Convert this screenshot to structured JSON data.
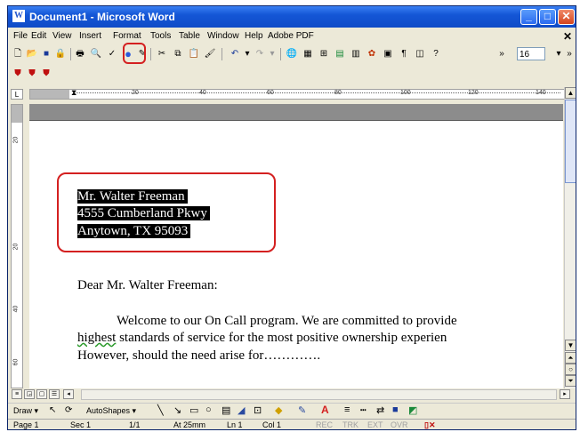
{
  "window": {
    "title": "Document1 - Microsoft Word",
    "title_buttons": [
      "_",
      "□",
      "✕"
    ]
  },
  "menubar": {
    "items": [
      "File",
      "Edit",
      "View",
      "Insert",
      "Format",
      "Tools",
      "Table",
      "Window",
      "Help",
      "Adobe PDF"
    ],
    "close_doc": "✕"
  },
  "toolbar": {
    "font_size": "16",
    "more": "»"
  },
  "ruler": {
    "ticks": [
      "20",
      "40",
      "60",
      "80",
      "100",
      "120",
      "140"
    ]
  },
  "vruler": {
    "ticks": [
      "20",
      "20",
      "40",
      "60"
    ]
  },
  "document": {
    "address_line1": "Mr. Walter Freeman",
    "address_line2": "4555 Cumberland Pkwy",
    "address_line3": "Anytown, TX 95093",
    "salutation": "Dear Mr. Walter Freeman:",
    "para_line1": "Welcome to our On Call program. We are committed to provide",
    "para_line2_word": "highest",
    "para_line2_rest": " standards of service for the most positive ownership experien",
    "para_line3": "However, should the need arise for…………."
  },
  "drawbar": {
    "draw_label": "Draw ▾",
    "autoshapes_label": "AutoShapes ▾"
  },
  "statusbar": {
    "page": "Page 1",
    "sec": "Sec 1",
    "pages": "1/1",
    "at": "At 25mm",
    "ln": "Ln 1",
    "col": "Col 1",
    "rec": "REC",
    "trk": "TRK",
    "ext": "EXT",
    "ovr": "OVR"
  },
  "colors": {
    "titlebar": "#1456d6",
    "highlight_box": "#d42020",
    "selection": "#000000"
  }
}
